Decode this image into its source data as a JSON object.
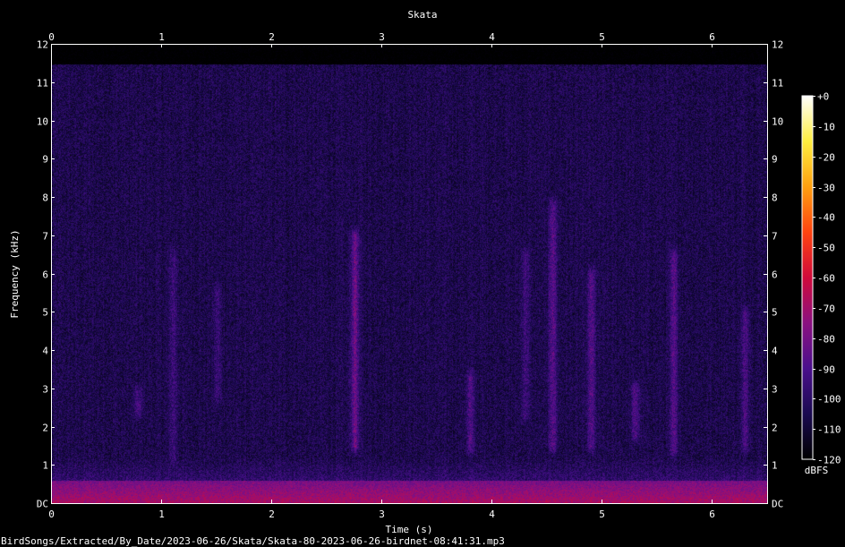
{
  "chart_data": {
    "type": "heatmap",
    "title": "Skata",
    "xlabel": "Time (s)",
    "ylabel": "Frequency (kHz)",
    "xlim": [
      0,
      6.5
    ],
    "ylim": [
      0,
      12
    ],
    "x_ticks": [
      0,
      1,
      2,
      3,
      4,
      5,
      6
    ],
    "y_ticks": [
      {
        "value": 0,
        "label": "DC"
      },
      {
        "value": 1,
        "label": "1"
      },
      {
        "value": 2,
        "label": "2"
      },
      {
        "value": 3,
        "label": "3"
      },
      {
        "value": 4,
        "label": "4"
      },
      {
        "value": 5,
        "label": "5"
      },
      {
        "value": 6,
        "label": "6"
      },
      {
        "value": 7,
        "label": "7"
      },
      {
        "value": 8,
        "label": "8"
      },
      {
        "value": 9,
        "label": "9"
      },
      {
        "value": 10,
        "label": "10"
      },
      {
        "value": 11,
        "label": "11"
      },
      {
        "value": 12,
        "label": "12"
      }
    ],
    "colorbar": {
      "label": "dBFS",
      "range": [
        -120,
        0
      ],
      "ticks": [
        "+0",
        "-10",
        "-20",
        "-30",
        "-40",
        "-50",
        "-60",
        "-70",
        "-80",
        "-90",
        "-100",
        "-110",
        "-120"
      ],
      "colors": [
        "#000000",
        "#1a0a50",
        "#4a0f8c",
        "#8a1080",
        "#d00a3a",
        "#ff4410",
        "#ffa010",
        "#ffee40",
        "#ffffff"
      ]
    },
    "grid": false,
    "events": [
      {
        "t": 0.78,
        "f_low": 2.4,
        "f_high": 2.9,
        "level_db": -92
      },
      {
        "t": 1.1,
        "f_low": 1.2,
        "f_high": 6.5,
        "level_db": -95
      },
      {
        "t": 1.5,
        "f_low": 2.8,
        "f_high": 5.6,
        "level_db": -96
      },
      {
        "t": 2.75,
        "f_low": 1.5,
        "f_high": 7.0,
        "level_db": -82
      },
      {
        "t": 3.8,
        "f_low": 1.5,
        "f_high": 3.3,
        "level_db": -90
      },
      {
        "t": 4.3,
        "f_low": 2.3,
        "f_high": 6.5,
        "level_db": -94
      },
      {
        "t": 4.55,
        "f_low": 1.5,
        "f_high": 7.8,
        "level_db": -87
      },
      {
        "t": 4.9,
        "f_low": 1.5,
        "f_high": 6.0,
        "level_db": -89
      },
      {
        "t": 5.3,
        "f_low": 1.8,
        "f_high": 3.0,
        "level_db": -90
      },
      {
        "t": 5.65,
        "f_low": 1.4,
        "f_high": 6.5,
        "level_db": -89
      },
      {
        "t": 6.3,
        "f_low": 1.5,
        "f_high": 5.0,
        "level_db": -91
      }
    ],
    "noise_floor_db": -105,
    "low_freq_band": {
      "f_high": 0.6,
      "level_db": -80
    },
    "content_cutoff_khz": 11.5
  },
  "footer": {
    "filepath": "BirdSongs/Extracted/By_Date/2023-06-26/Skata/Skata-80-2023-06-26-birdnet-08:41:31.mp3"
  }
}
